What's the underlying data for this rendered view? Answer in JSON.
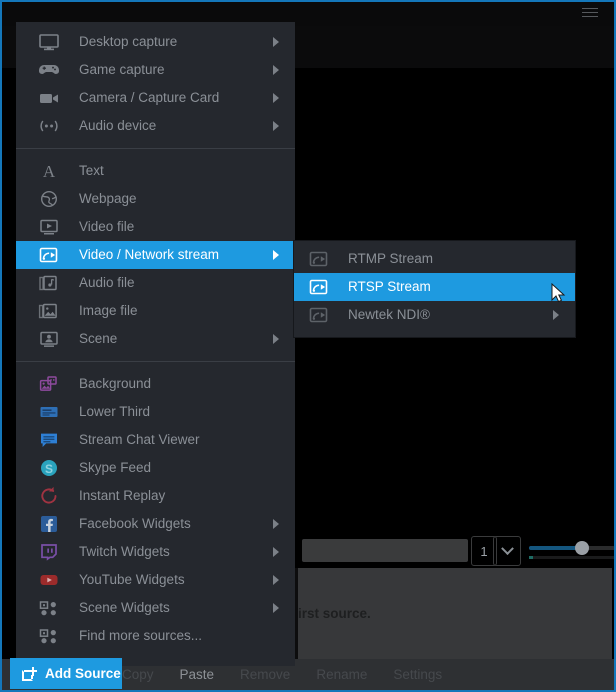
{
  "window": {
    "accent_border_color": "#1477ba",
    "menu_bg_color": "#25282e",
    "highlight_color": "#1e9ae0",
    "text_color": "#8b9097"
  },
  "context_menu": {
    "name": "add-source-menu",
    "groups": [
      {
        "items": [
          {
            "label": "Desktop capture",
            "icon": "monitor-icon",
            "submenu": true
          },
          {
            "label": "Game capture",
            "icon": "gamepad-icon",
            "submenu": true
          },
          {
            "label": "Camera / Capture Card",
            "icon": "camera-icon",
            "submenu": true
          },
          {
            "label": "Audio device",
            "icon": "audio-wave-icon",
            "submenu": true
          }
        ]
      },
      {
        "items": [
          {
            "label": "Text",
            "icon": "text-a-icon",
            "submenu": false
          },
          {
            "label": "Webpage",
            "icon": "globe-icon",
            "submenu": false
          },
          {
            "label": "Video file",
            "icon": "video-play-icon",
            "submenu": false
          },
          {
            "label": "Video / Network stream",
            "icon": "network-stream-icon",
            "submenu": true,
            "selected": true
          },
          {
            "label": "Audio file",
            "icon": "music-note-icon",
            "submenu": false
          },
          {
            "label": "Image file",
            "icon": "image-stack-icon",
            "submenu": false
          },
          {
            "label": "Scene",
            "icon": "scene-icon",
            "submenu": true
          }
        ]
      },
      {
        "items": [
          {
            "label": "Background",
            "icon": "background-icon",
            "submenu": false,
            "color": "#8e4a9e"
          },
          {
            "label": "Lower Third",
            "icon": "lower-third-icon",
            "submenu": false,
            "color": "#2e6fb5"
          },
          {
            "label": "Stream Chat Viewer",
            "icon": "chat-bubble-icon",
            "submenu": false,
            "color": "#2e7fd4"
          },
          {
            "label": "Skype Feed",
            "icon": "skype-icon",
            "submenu": false,
            "color": "#2aa3bd"
          },
          {
            "label": "Instant Replay",
            "icon": "replay-icon",
            "submenu": false,
            "color": "#a03341"
          },
          {
            "label": "Facebook Widgets",
            "icon": "facebook-icon",
            "submenu": true,
            "color": "#2b5c99"
          },
          {
            "label": "Twitch Widgets",
            "icon": "twitch-icon",
            "submenu": true,
            "color": "#7a4fa8"
          },
          {
            "label": "YouTube Widgets",
            "icon": "youtube-icon",
            "submenu": true,
            "color": "#9c2b2b"
          },
          {
            "label": "Scene Widgets",
            "icon": "widgets-grid-icon",
            "submenu": true,
            "color": "#7c8188"
          },
          {
            "label": "Find more sources...",
            "icon": "widgets-grid-icon",
            "submenu": false,
            "color": "#7c8188"
          }
        ]
      }
    ]
  },
  "submenu": {
    "name": "video-network-stream-submenu",
    "items": [
      {
        "label": "RTMP Stream",
        "icon": "network-stream-icon",
        "submenu": false,
        "selected": false
      },
      {
        "label": "RTSP Stream",
        "icon": "network-stream-icon",
        "submenu": false,
        "selected": true
      },
      {
        "label": "Newtek NDI®",
        "icon": "network-stream-icon",
        "submenu": true,
        "selected": false
      }
    ]
  },
  "add_source_button": {
    "label": "Add Source",
    "icon": "add-frame-plus-icon"
  },
  "bottom_toolbar": {
    "items": [
      {
        "label": "Copy",
        "enabled": false
      },
      {
        "label": "Paste",
        "enabled": true
      },
      {
        "label": "Remove",
        "enabled": false
      },
      {
        "label": "Rename",
        "enabled": false
      },
      {
        "label": "Settings",
        "enabled": false
      }
    ]
  },
  "background_ui": {
    "hint_text": "irst source.",
    "spinner_value": "1",
    "search_input_value": "",
    "slider_percent": 70
  }
}
